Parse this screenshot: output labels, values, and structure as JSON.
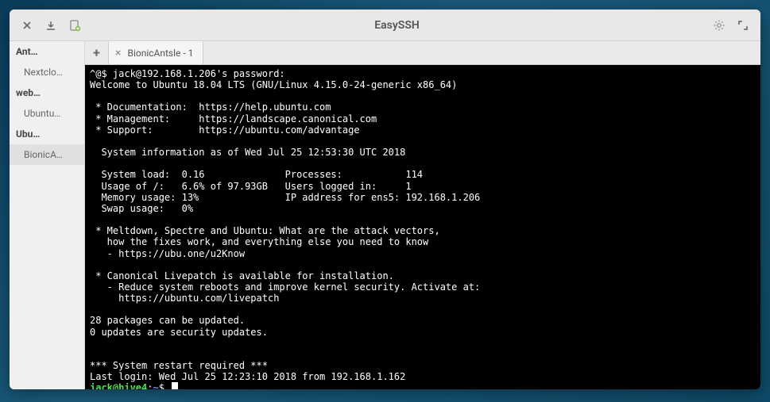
{
  "app": {
    "title": "EasySSH"
  },
  "sidebar": {
    "groups": [
      {
        "label": "Ant…",
        "hosts": [
          {
            "label": "Nextclo…"
          }
        ]
      },
      {
        "label": "web…",
        "hosts": [
          {
            "label": "Ubuntu…"
          }
        ]
      },
      {
        "label": "Ubu…",
        "hosts": [
          {
            "label": "BionicA…"
          }
        ]
      }
    ]
  },
  "tabs": {
    "items": [
      {
        "label": "BionicAntsle - 1"
      }
    ]
  },
  "terminal": {
    "lines": [
      "^@$ jack@192.168.1.206's password:",
      "Welcome to Ubuntu 18.04 LTS (GNU/Linux 4.15.0-24-generic x86_64)",
      "",
      " * Documentation:  https://help.ubuntu.com",
      " * Management:     https://landscape.canonical.com",
      " * Support:        https://ubuntu.com/advantage",
      "",
      "  System information as of Wed Jul 25 12:53:30 UTC 2018",
      "",
      "  System load:  0.16              Processes:           114",
      "  Usage of /:   6.6% of 97.93GB   Users logged in:     1",
      "  Memory usage: 13%               IP address for ens5: 192.168.1.206",
      "  Swap usage:   0%",
      "",
      " * Meltdown, Spectre and Ubuntu: What are the attack vectors,",
      "   how the fixes work, and everything else you need to know",
      "   - https://ubu.one/u2Know",
      "",
      " * Canonical Livepatch is available for installation.",
      "   - Reduce system reboots and improve kernel security. Activate at:",
      "     https://ubuntu.com/livepatch",
      "",
      "28 packages can be updated.",
      "0 updates are security updates.",
      "",
      "",
      "*** System restart required ***",
      "Last login: Wed Jul 25 12:23:10 2018 from 192.168.1.162"
    ],
    "prompt": {
      "user_host": "jack@hive4",
      "sep": ":",
      "path": "~",
      "suffix": "$ "
    }
  }
}
